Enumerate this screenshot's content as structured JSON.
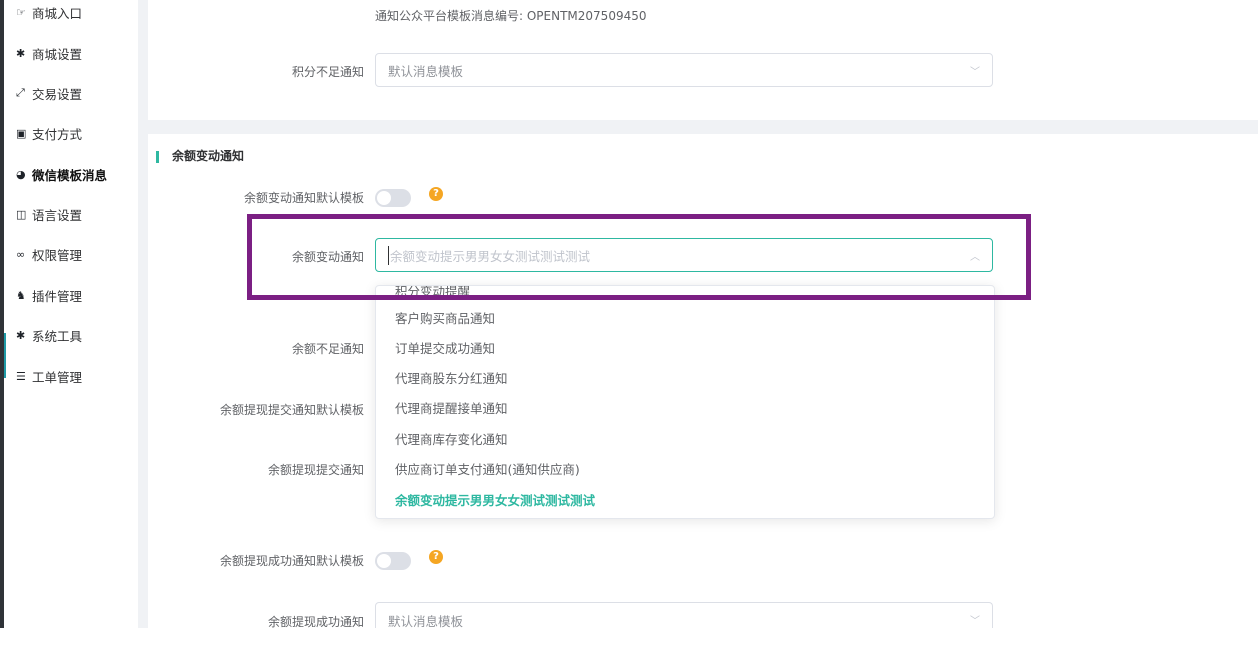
{
  "sidebar": {
    "items": [
      {
        "icon": "☞",
        "label": "商城入口"
      },
      {
        "icon": "✱",
        "label": "商城设置"
      },
      {
        "icon": "⤢",
        "label": "交易设置"
      },
      {
        "icon": "▣",
        "label": "支付方式"
      },
      {
        "icon": "◕",
        "label": "微信模板消息"
      },
      {
        "icon": "◫",
        "label": "语言设置"
      },
      {
        "icon": "∞",
        "label": "权限管理"
      },
      {
        "icon": "♞",
        "label": "插件管理"
      },
      {
        "icon": "✱",
        "label": "系统工具"
      },
      {
        "icon": "☰",
        "label": "工单管理"
      }
    ]
  },
  "top_card": {
    "hint": "通知公众平台模板消息编号: OPENTM207509450",
    "points_label": "积分不足通知",
    "points_value": "默认消息模板"
  },
  "section": {
    "title": "余额变动通知",
    "default_template_label": "余额变动通知默认模板",
    "balance_change_label": "余额变动通知",
    "balance_change_value": "余额变动提示男男女女测试测试测试",
    "insufficient_label": "余额不足通知",
    "withdraw_submit_default_label": "余额提现提交通知默认模板",
    "withdraw_submit_label": "余额提现提交通知",
    "withdraw_success_default_label": "余额提现成功通知默认模板",
    "withdraw_success_label": "余额提现成功通知",
    "withdraw_success_value": "默认消息模板",
    "help_symbol": "?"
  },
  "dropdown": {
    "options": [
      "积分变动提醒",
      "客户购买商品通知",
      "订单提交成功通知",
      "代理商股东分红通知",
      "代理商提醒接单通知",
      "代理商库存变化通知",
      "供应商订单支付通知(通知供应商)",
      "余额变动提示男男女女测试测试测试"
    ],
    "selected_index": 7
  },
  "colors": {
    "accent": "#2eb8a1",
    "highlight": "#7b1f83",
    "help": "#f5a623"
  }
}
